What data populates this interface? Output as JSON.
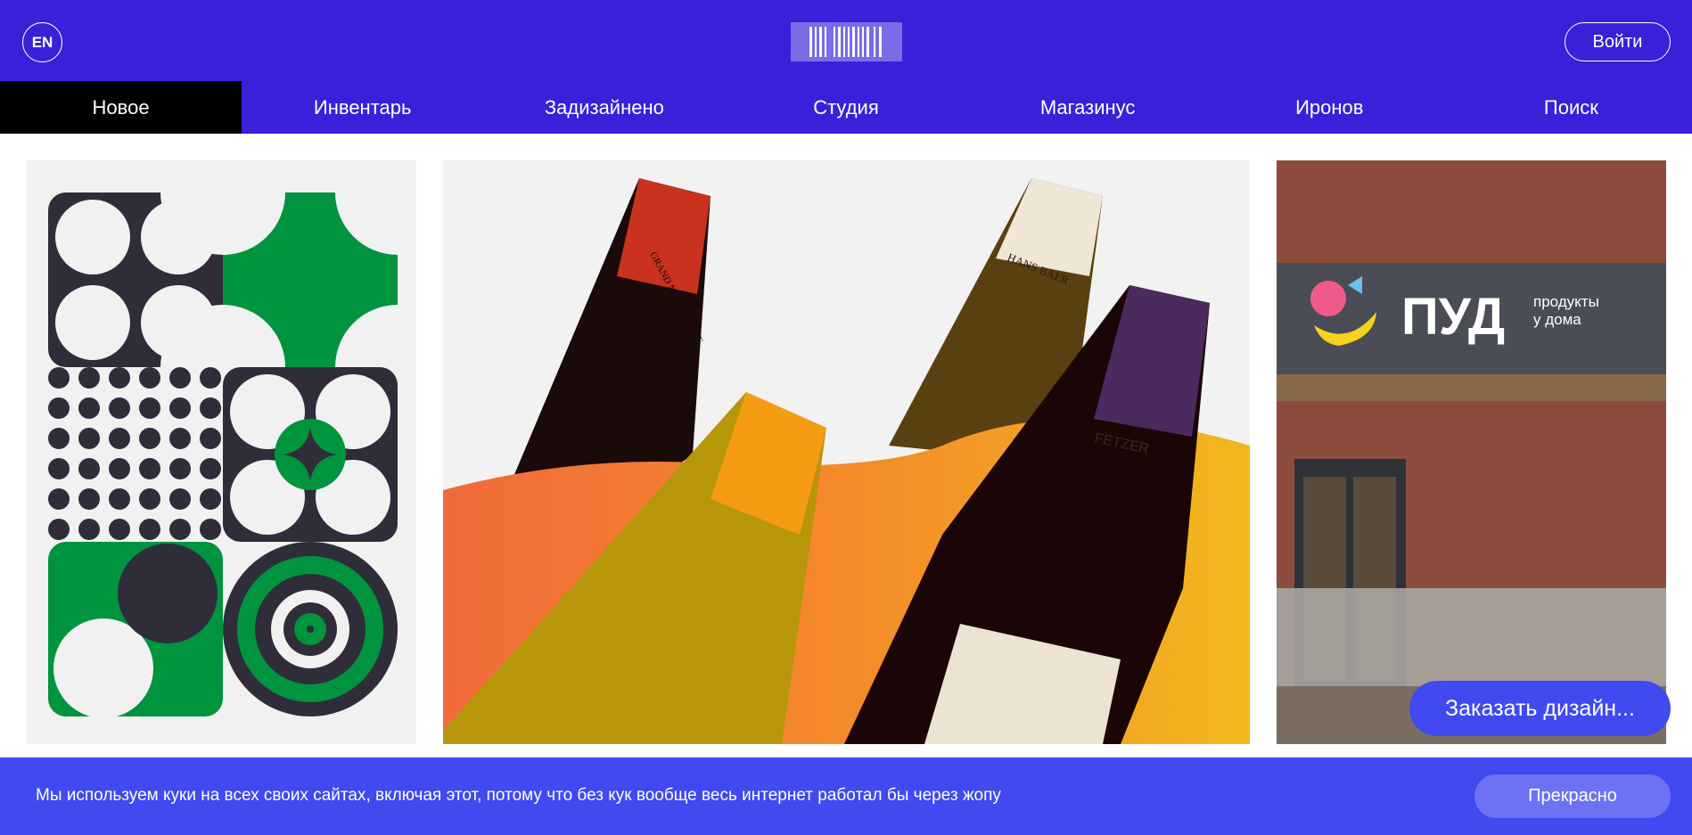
{
  "header": {
    "lang": "EN",
    "login": "Войти"
  },
  "nav": [
    {
      "label": "Новое",
      "active": true
    },
    {
      "label": "Инвентарь"
    },
    {
      "label": "Задизайнено"
    },
    {
      "label": "Студия"
    },
    {
      "label": "Магазинус"
    },
    {
      "label": "Иронов"
    },
    {
      "label": "Поиск"
    }
  ],
  "cards": {
    "store_sign": "ПУД",
    "store_tagline_1": "продукты",
    "store_tagline_2": "у дома",
    "wine_labels": [
      "GRAND NOIR FRANCE",
      "HANS BAER",
      "FETZER"
    ]
  },
  "order_button": "Заказать дизайн...",
  "cookie": {
    "text": "Мы используем куки на всех своих сайтах, включая этот, потому что без кук вообще весь интернет работал бы через жопу",
    "accept": "Прекрасно"
  },
  "colors": {
    "brand": "#3920d9",
    "accent": "#4149f0"
  }
}
